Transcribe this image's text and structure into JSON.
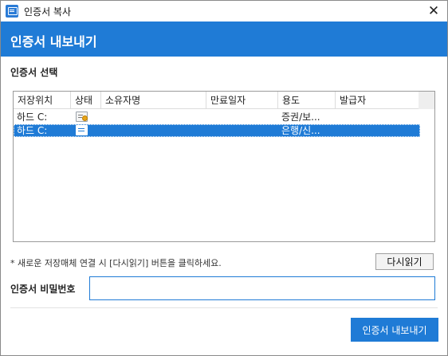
{
  "window": {
    "title": "인증서 복사",
    "close_glyph": "✕"
  },
  "header": {
    "title": "인증서 내보내기",
    "background": "#1f7bd6"
  },
  "selection": {
    "label": "인증서 선택",
    "columns": [
      "저장위치",
      "상태",
      "소유자명",
      "만료일자",
      "용도",
      "발급자"
    ],
    "rows": [
      {
        "location": "하드 C:",
        "status_icon": "certificate-icon",
        "owner": "",
        "expiry": "",
        "usage": "증권/보...",
        "issuer": "",
        "selected": false
      },
      {
        "location": "하드 C:",
        "status_icon": "certificate-icon",
        "owner": "",
        "expiry": "",
        "usage": "은행/신...",
        "issuer": "",
        "selected": true
      }
    ]
  },
  "notice": "* 새로운 저장매체 연결 시 [다시읽기] 버튼을 클릭하세요.",
  "reload_button": "다시읽기",
  "password": {
    "label": "인증서 비밀번호",
    "value": "",
    "placeholder": ""
  },
  "export_button": "인증서 내보내기"
}
